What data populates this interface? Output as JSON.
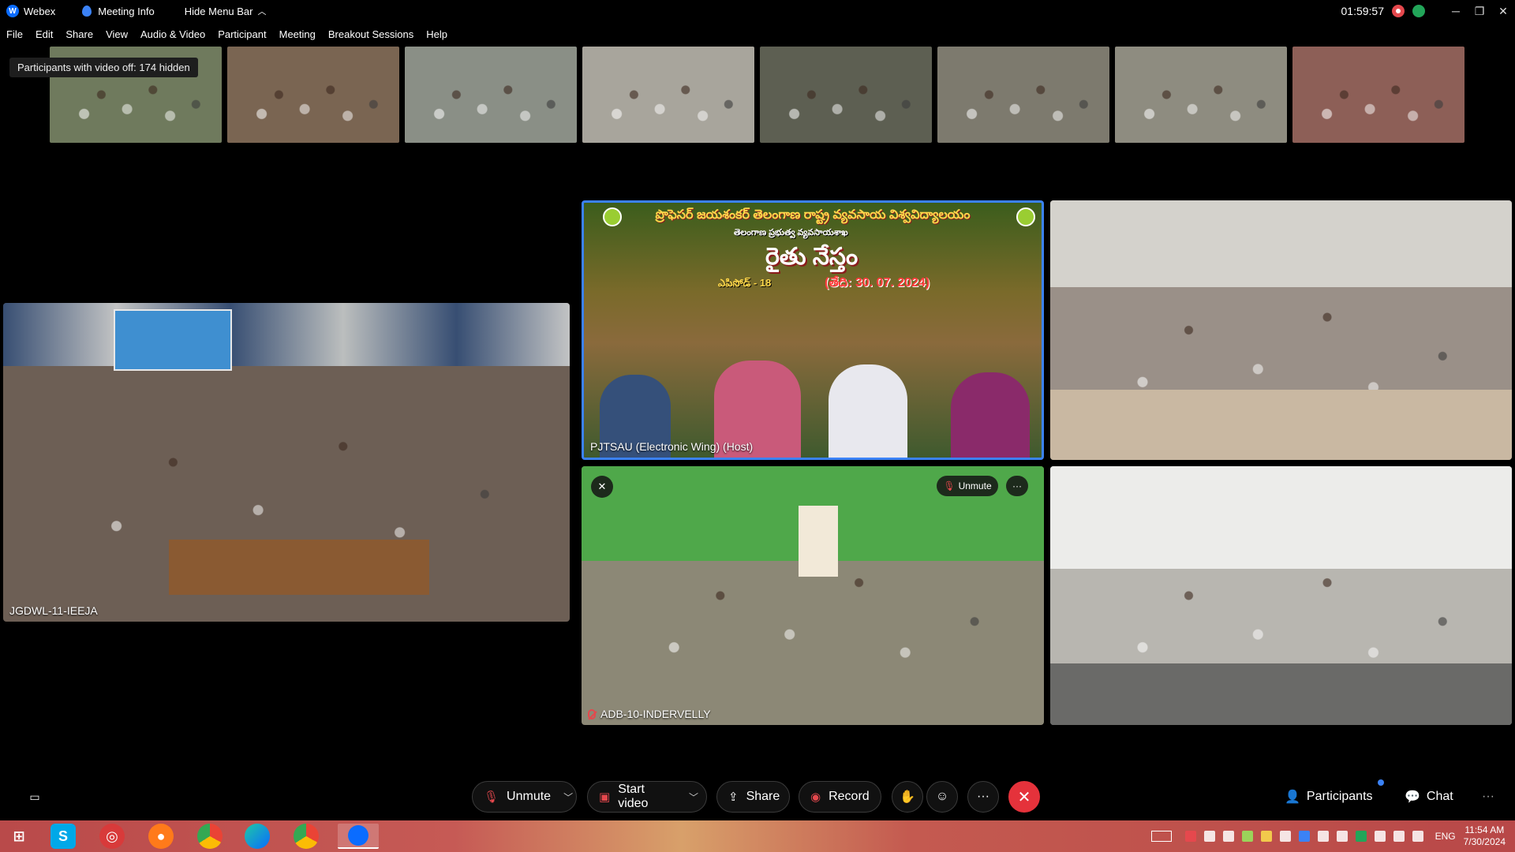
{
  "titlebar": {
    "app_name": "Webex",
    "meeting_info_label": "Meeting Info",
    "hide_menu_label": "Hide Menu Bar",
    "timer": "01:59:57"
  },
  "menu": {
    "items": [
      "File",
      "Edit",
      "Share",
      "View",
      "Audio & Video",
      "Participant",
      "Meeting",
      "Breakout Sessions",
      "Help"
    ]
  },
  "tooltip": "Participants with video off: 174 hidden",
  "thumbnails": [
    {
      "color": "#6f7a5d"
    },
    {
      "color": "#7a6552"
    },
    {
      "color": "#8a8f86"
    },
    {
      "color": "#a8a59c"
    },
    {
      "color": "#5d5f52"
    },
    {
      "color": "#7d7a6e"
    },
    {
      "color": "#8e8c80"
    },
    {
      "color": "#8d5f57"
    }
  ],
  "tiles": {
    "left": {
      "label": "JGDWL-11-IEEJA"
    },
    "host": {
      "label": "PJTSAU (Electronic Wing) (Host)",
      "banner_title": "ప్రొఫెసర్ జయశంకర్ తెలంగాణ రాష్ట్ర వ్యవసాయ విశ్వవిద్యాలయం",
      "banner_sub": "తెలంగాణ ప్రభుత్వ వ్యవసాయశాఖ",
      "banner_big": "రైతు నేస్తం",
      "banner_episode": "ఎపిసోడ్ - 18",
      "banner_date": "(తేది: 30. 07. 2024)"
    },
    "mid": {
      "label": "ADB-10-INDERVELLY",
      "unmute_label": "Unmute",
      "more_label": "···"
    }
  },
  "controls": {
    "unmute": "Unmute",
    "start_video": "Start video",
    "share": "Share",
    "record": "Record",
    "more": "···",
    "participants": "Participants",
    "chat": "Chat",
    "overflow": "···"
  },
  "taskbar": {
    "language": "ENG",
    "time": "11:54 AM",
    "date": "7/30/2024"
  },
  "colors": {
    "accent": "#3b82f6",
    "end_call": "#e5323b",
    "recording": "#e5484d"
  }
}
